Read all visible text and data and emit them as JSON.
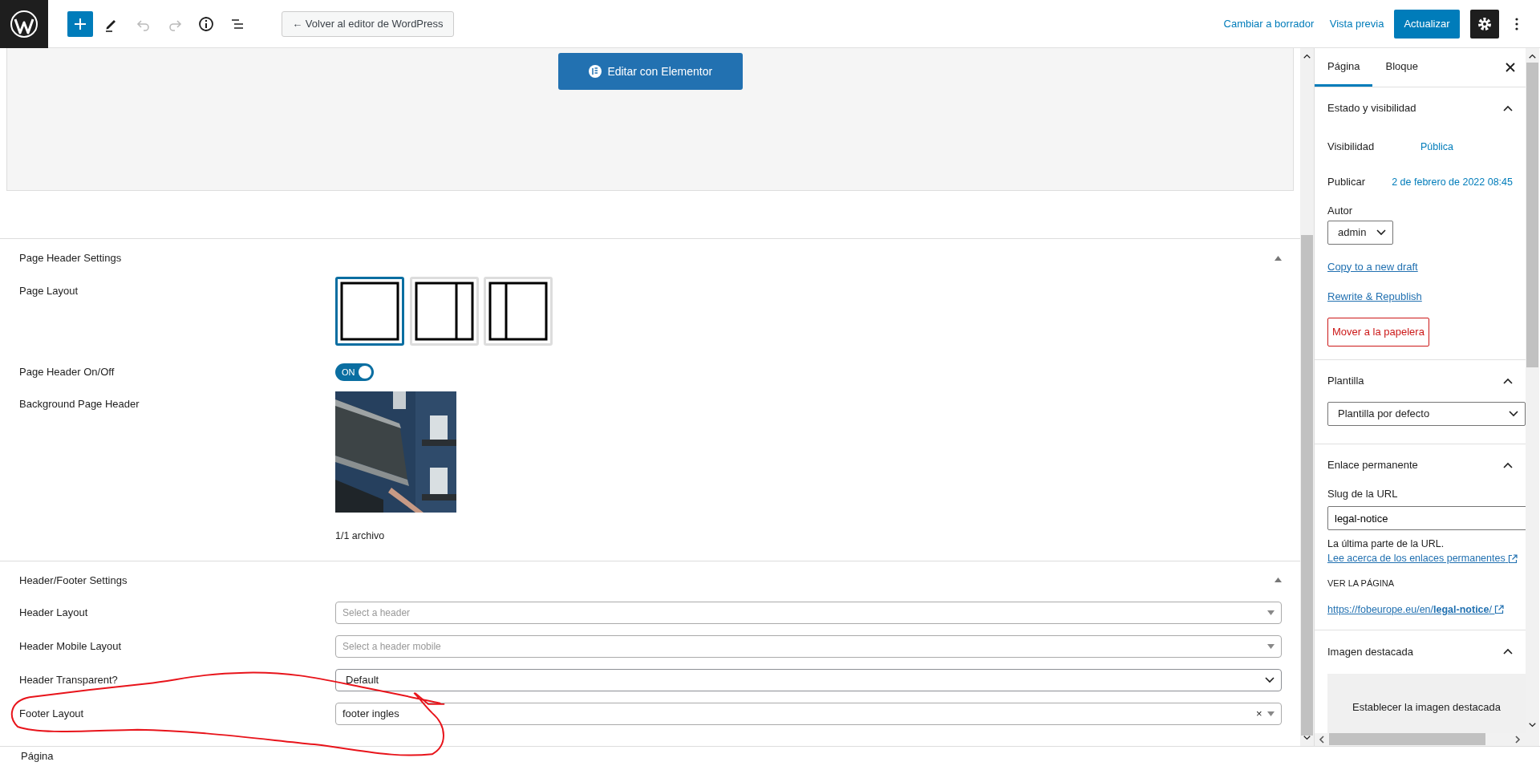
{
  "topbar": {
    "toolbar": [
      {
        "kind": "add",
        "disabled": false
      },
      {
        "kind": "edit",
        "disabled": false
      },
      {
        "kind": "undo",
        "disabled": true
      },
      {
        "kind": "redo",
        "disabled": true
      },
      {
        "kind": "info",
        "disabled": false
      },
      {
        "kind": "outline",
        "disabled": false
      }
    ],
    "back_button": "← Volver al editor de WordPress",
    "links": [
      "Cambiar a borrador",
      "Vista previa"
    ],
    "update_button": "Actualizar",
    "settings_selected": true
  },
  "editor": {
    "elementor_button": "Editar con Elementor"
  },
  "meta_boxes": [
    {
      "title": "Page Header Settings",
      "expanded": true,
      "fields": [
        {
          "kind": "layout",
          "label": "Page Layout",
          "options": [
            {
              "kind": "full",
              "selected": true
            },
            {
              "kind": "right",
              "selected": false
            },
            {
              "kind": "left",
              "selected": false
            }
          ]
        },
        {
          "kind": "toggle",
          "label": "Page Header On/Off",
          "text": "ON",
          "on": true
        },
        {
          "label": "Background Page Header",
          "caption": "1/1 archivo"
        }
      ]
    },
    {
      "title": "Header/Footer Settings",
      "expanded": true,
      "fields": [
        {
          "kind": "select2",
          "label": "Header Layout",
          "placeholder": "Select a header"
        },
        {
          "kind": "select2",
          "label": "Header Mobile Layout",
          "placeholder": "Select a header mobile"
        },
        {
          "kind": "select",
          "label": "Header Transparent?",
          "value": "Default"
        },
        {
          "kind": "select2",
          "label": "Footer Layout",
          "value": "footer ingles",
          "clear": "×"
        }
      ]
    }
  ],
  "sidebar": {
    "tabs": [
      {
        "label": "Página",
        "selected": true
      },
      {
        "label": "Bloque",
        "selected": false
      }
    ],
    "panels": [
      {
        "kind": "status",
        "title": "Estado y visibilidad",
        "expanded": true,
        "rows": [
          {
            "label": "Visibilidad",
            "value": "Pública"
          },
          {
            "label": "Publicar",
            "value": "2 de febrero de 2022 08:45"
          }
        ],
        "author_label": "Autor",
        "author": "admin",
        "links": [
          "Copy to a new draft",
          "Rewrite & Republish"
        ],
        "trash_button": "Mover a la papelera"
      },
      {
        "kind": "template",
        "title": "Plantilla",
        "expanded": true,
        "template": "Plantilla por defecto"
      },
      {
        "kind": "permalink",
        "title": "Enlace permanente",
        "expanded": true,
        "slug_label": "Slug de la URL",
        "slug": "legal-notice",
        "help": "La última parte de la URL.",
        "help_link": "Lee acerca de los enlaces permanentes",
        "view_label": "VER LA PÁGINA",
        "url": "https://fobeurope.eu/en/**legal-notice**/"
      },
      {
        "kind": "featured",
        "title": "Imagen destacada",
        "expanded": true,
        "button": "Establecer la imagen destacada"
      }
    ]
  },
  "status_bar": {
    "breadcrumb": "Página"
  }
}
